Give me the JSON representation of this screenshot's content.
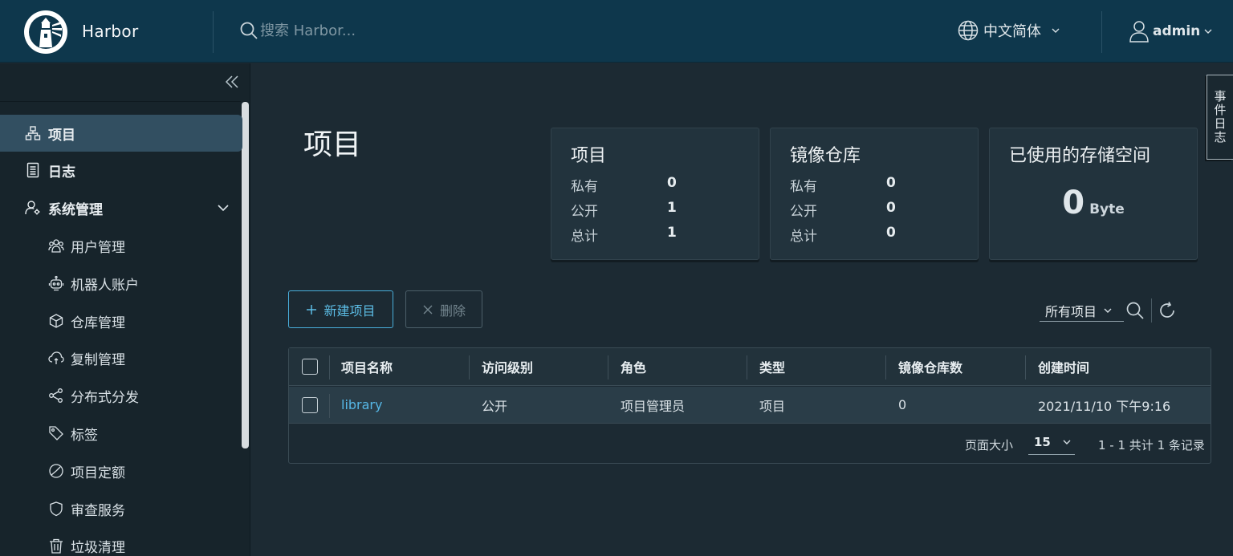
{
  "header": {
    "app_name": "Harbor",
    "search_placeholder": "搜索 Harbor...",
    "language": "中文简体",
    "username": "admin"
  },
  "sidebar": {
    "items": [
      {
        "label": "项目",
        "icon": "projects-icon",
        "active": true
      },
      {
        "label": "日志",
        "icon": "logs-icon"
      },
      {
        "label": "系统管理",
        "icon": "system-admin-icon",
        "expanded": true
      },
      {
        "label": "用户管理",
        "icon": "users-icon"
      },
      {
        "label": "机器人账户",
        "icon": "robot-icon"
      },
      {
        "label": "仓库管理",
        "icon": "registry-icon"
      },
      {
        "label": "复制管理",
        "icon": "replication-icon"
      },
      {
        "label": "分布式分发",
        "icon": "distribution-icon"
      },
      {
        "label": "标签",
        "icon": "tag-icon"
      },
      {
        "label": "项目定额",
        "icon": "quota-icon"
      },
      {
        "label": "审查服务",
        "icon": "shield-icon"
      },
      {
        "label": "垃圾清理",
        "icon": "trash-icon"
      }
    ]
  },
  "main": {
    "title": "项目",
    "cards": {
      "projects": {
        "title": "项目",
        "rows": [
          {
            "label": "私有",
            "value": "0"
          },
          {
            "label": "公开",
            "value": "1"
          },
          {
            "label": "总计",
            "value": "1"
          }
        ]
      },
      "repos": {
        "title": "镜像仓库",
        "rows": [
          {
            "label": "私有",
            "value": "0"
          },
          {
            "label": "公开",
            "value": "0"
          },
          {
            "label": "总计",
            "value": "0"
          }
        ]
      },
      "storage": {
        "title": "已使用的存储空间",
        "value": "0",
        "unit": "Byte"
      }
    },
    "actions": {
      "new_project": "新建项目",
      "delete": "删除"
    },
    "filter": {
      "selected": "所有项目"
    },
    "table": {
      "columns": [
        "项目名称",
        "访问级别",
        "角色",
        "类型",
        "镜像仓库数",
        "创建时间"
      ],
      "rows": [
        {
          "name": "library",
          "access": "公开",
          "role": "项目管理员",
          "type": "项目",
          "repo_count": "0",
          "created": "2021/11/10 下午9:16"
        }
      ],
      "footer": {
        "page_size_label": "页面大小",
        "page_size": "15",
        "summary": "1 - 1 共计 1 条记录"
      }
    },
    "event_log_tab": "事件日志"
  },
  "colors": {
    "header_bg": "#0e374c",
    "sidebar_bg": "#17242b",
    "main_bg": "#1c2a33",
    "accent": "#49aedb",
    "active_nav": "#324f61"
  }
}
